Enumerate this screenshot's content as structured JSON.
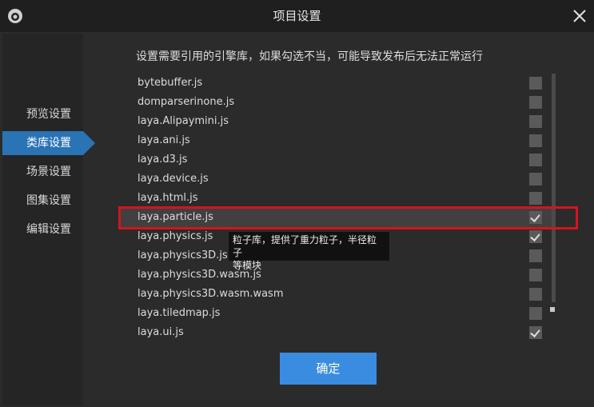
{
  "window": {
    "title": "项目设置"
  },
  "icons": {
    "logo": "app-logo-icon",
    "close": "close-icon",
    "check": "checkmark-icon"
  },
  "colors": {
    "accent": "#2a73b4",
    "button": "#3a8ce0",
    "highlight_border": "#d4141d"
  },
  "sidebar": {
    "items": [
      {
        "label": "预览设置",
        "active": false
      },
      {
        "label": "类库设置",
        "active": true
      },
      {
        "label": "场景设置",
        "active": false
      },
      {
        "label": "图集设置",
        "active": false
      },
      {
        "label": "编辑设置",
        "active": false
      }
    ]
  },
  "main": {
    "intro": "设置需要引用的引擎库，如果勾选不当，可能导致发布后无法正常运行",
    "libraries": [
      {
        "name": "bytebuffer.js",
        "checked": false
      },
      {
        "name": "domparserinone.js",
        "checked": false
      },
      {
        "name": "laya.Alipaymini.js",
        "checked": false
      },
      {
        "name": "laya.ani.js",
        "checked": false
      },
      {
        "name": "laya.d3.js",
        "checked": false
      },
      {
        "name": "laya.device.js",
        "checked": false
      },
      {
        "name": "laya.html.js",
        "checked": false
      },
      {
        "name": "laya.particle.js",
        "checked": true
      },
      {
        "name": "laya.physics.js",
        "checked": true
      },
      {
        "name": "laya.physics3D.js",
        "checked": false
      },
      {
        "name": "laya.physics3D.wasm.js",
        "checked": false
      },
      {
        "name": "laya.physics3D.wasm.wasm",
        "checked": false
      },
      {
        "name": "laya.tiledmap.js",
        "checked": false
      },
      {
        "name": "laya.ui.js",
        "checked": true
      }
    ],
    "tooltip": {
      "line1": "粒子库，提供了重力粒子，半径粒子",
      "line2": "等模块"
    },
    "confirm_label": "确定"
  }
}
